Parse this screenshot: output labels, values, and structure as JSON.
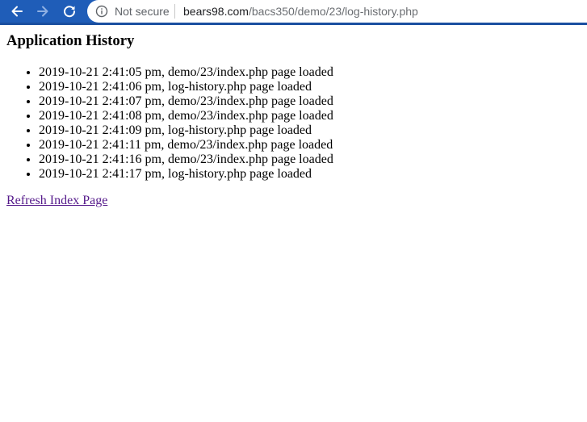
{
  "browser": {
    "security_label": "Not secure",
    "url_host": "bears98.com",
    "url_path": "/bacs350/demo/23/log-history.php",
    "icons": {
      "back": "arrow-left-icon",
      "forward": "arrow-right-icon",
      "reload": "reload-icon",
      "info": "info-circle-icon"
    },
    "colors": {
      "toolbar": "#1f5db8",
      "omnibox": "#ffffff"
    }
  },
  "page": {
    "title": "Application History",
    "history": [
      "2019-10-21 2:41:05 pm, demo/23/index.php page loaded",
      "2019-10-21 2:41:06 pm, log-history.php page loaded",
      "2019-10-21 2:41:07 pm, demo/23/index.php page loaded",
      "2019-10-21 2:41:08 pm, demo/23/index.php page loaded",
      "2019-10-21 2:41:09 pm, log-history.php page loaded",
      "2019-10-21 2:41:11 pm, demo/23/index.php page loaded",
      "2019-10-21 2:41:16 pm, demo/23/index.php page loaded",
      "2019-10-21 2:41:17 pm, log-history.php page loaded"
    ],
    "refresh_link": "Refresh Index Page",
    "colors": {
      "visited_link": "#551a8b"
    }
  }
}
